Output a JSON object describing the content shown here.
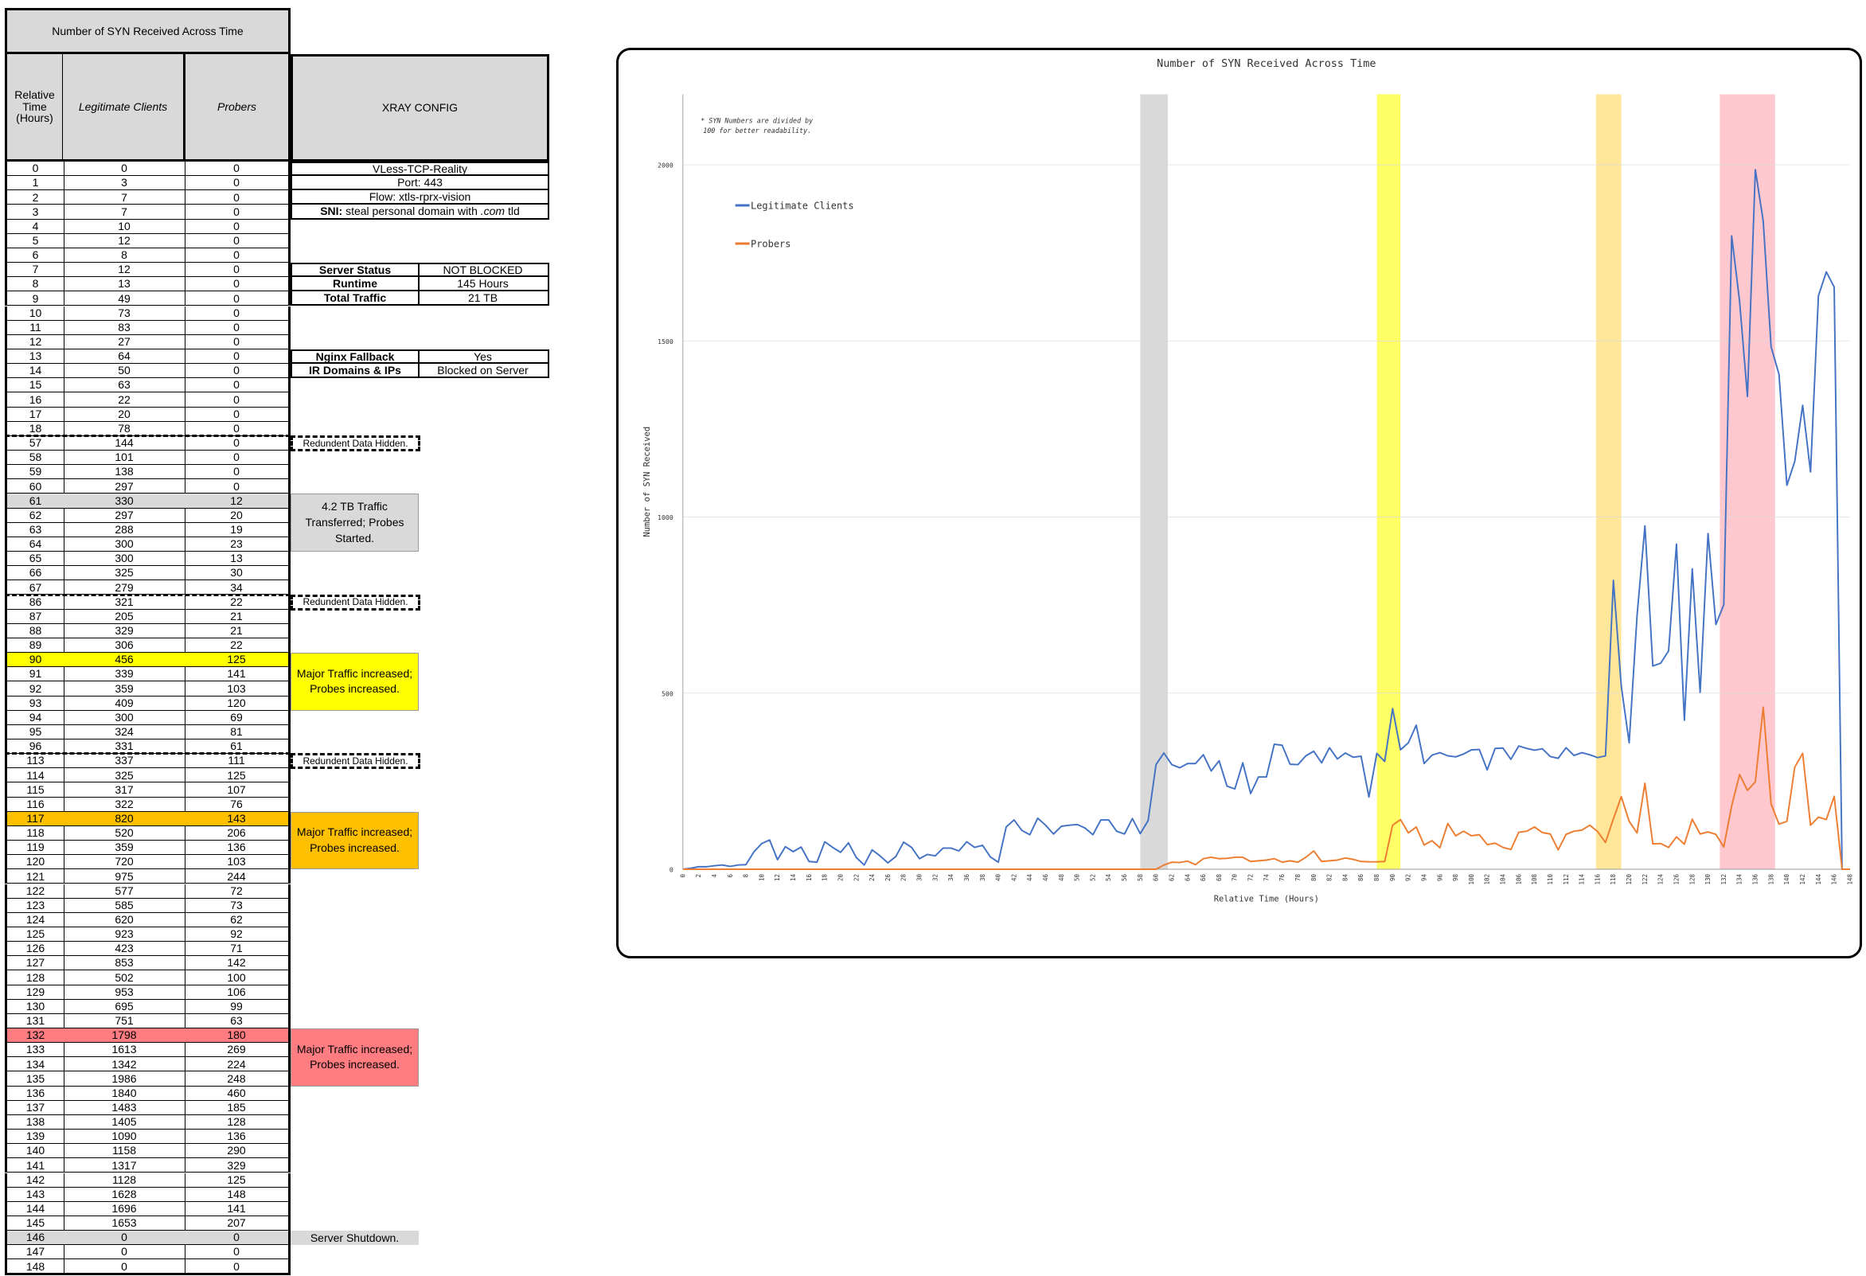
{
  "table": {
    "title": "Number of SYN Received Across Time",
    "col_time": "Relative Time (Hours)",
    "col_legit": "Legitimate Clients",
    "col_probers": "Probers",
    "rows": [
      {
        "t": "0",
        "l": "0",
        "p": "0"
      },
      {
        "t": "1",
        "l": "3",
        "p": "0"
      },
      {
        "t": "2",
        "l": "7",
        "p": "0"
      },
      {
        "t": "3",
        "l": "7",
        "p": "0"
      },
      {
        "t": "4",
        "l": "10",
        "p": "0"
      },
      {
        "t": "5",
        "l": "12",
        "p": "0"
      },
      {
        "t": "6",
        "l": "8",
        "p": "0"
      },
      {
        "t": "7",
        "l": "12",
        "p": "0"
      },
      {
        "t": "8",
        "l": "13",
        "p": "0"
      },
      {
        "t": "9",
        "l": "49",
        "p": "0"
      },
      {
        "t": "10",
        "l": "73",
        "p": "0"
      },
      {
        "t": "11",
        "l": "83",
        "p": "0"
      },
      {
        "t": "12",
        "l": "27",
        "p": "0"
      },
      {
        "t": "13",
        "l": "64",
        "p": "0"
      },
      {
        "t": "14",
        "l": "50",
        "p": "0"
      },
      {
        "t": "15",
        "l": "63",
        "p": "0"
      },
      {
        "t": "16",
        "l": "22",
        "p": "0"
      },
      {
        "t": "17",
        "l": "20",
        "p": "0"
      },
      {
        "t": "18",
        "l": "78",
        "p": "0"
      },
      {
        "t": "57",
        "l": "144",
        "p": "0"
      },
      {
        "t": "58",
        "l": "101",
        "p": "0"
      },
      {
        "t": "59",
        "l": "138",
        "p": "0"
      },
      {
        "t": "60",
        "l": "297",
        "p": "0"
      },
      {
        "t": "61",
        "l": "330",
        "p": "12"
      },
      {
        "t": "62",
        "l": "297",
        "p": "20"
      },
      {
        "t": "63",
        "l": "288",
        "p": "19"
      },
      {
        "t": "64",
        "l": "300",
        "p": "23"
      },
      {
        "t": "65",
        "l": "300",
        "p": "13"
      },
      {
        "t": "66",
        "l": "325",
        "p": "30"
      },
      {
        "t": "67",
        "l": "279",
        "p": "34"
      },
      {
        "t": "86",
        "l": "321",
        "p": "22"
      },
      {
        "t": "87",
        "l": "205",
        "p": "21"
      },
      {
        "t": "88",
        "l": "329",
        "p": "21"
      },
      {
        "t": "89",
        "l": "306",
        "p": "22"
      },
      {
        "t": "90",
        "l": "456",
        "p": "125"
      },
      {
        "t": "91",
        "l": "339",
        "p": "141"
      },
      {
        "t": "92",
        "l": "359",
        "p": "103"
      },
      {
        "t": "93",
        "l": "409",
        "p": "120"
      },
      {
        "t": "94",
        "l": "300",
        "p": "69"
      },
      {
        "t": "95",
        "l": "324",
        "p": "81"
      },
      {
        "t": "96",
        "l": "331",
        "p": "61"
      },
      {
        "t": "113",
        "l": "337",
        "p": "111"
      },
      {
        "t": "114",
        "l": "325",
        "p": "125"
      },
      {
        "t": "115",
        "l": "317",
        "p": "107"
      },
      {
        "t": "116",
        "l": "322",
        "p": "76"
      },
      {
        "t": "117",
        "l": "820",
        "p": "143"
      },
      {
        "t": "118",
        "l": "520",
        "p": "206"
      },
      {
        "t": "119",
        "l": "359",
        "p": "136"
      },
      {
        "t": "120",
        "l": "720",
        "p": "103"
      },
      {
        "t": "121",
        "l": "975",
        "p": "244"
      },
      {
        "t": "122",
        "l": "577",
        "p": "72"
      },
      {
        "t": "123",
        "l": "585",
        "p": "73"
      },
      {
        "t": "124",
        "l": "620",
        "p": "62"
      },
      {
        "t": "125",
        "l": "923",
        "p": "92"
      },
      {
        "t": "126",
        "l": "423",
        "p": "71"
      },
      {
        "t": "127",
        "l": "853",
        "p": "142"
      },
      {
        "t": "128",
        "l": "502",
        "p": "100"
      },
      {
        "t": "129",
        "l": "953",
        "p": "106"
      },
      {
        "t": "130",
        "l": "695",
        "p": "99"
      },
      {
        "t": "131",
        "l": "751",
        "p": "63"
      },
      {
        "t": "132",
        "l": "1798",
        "p": "180"
      },
      {
        "t": "133",
        "l": "1613",
        "p": "269"
      },
      {
        "t": "134",
        "l": "1342",
        "p": "224"
      },
      {
        "t": "135",
        "l": "1986",
        "p": "248"
      },
      {
        "t": "136",
        "l": "1840",
        "p": "460"
      },
      {
        "t": "137",
        "l": "1483",
        "p": "185"
      },
      {
        "t": "138",
        "l": "1405",
        "p": "128"
      },
      {
        "t": "139",
        "l": "1090",
        "p": "136"
      },
      {
        "t": "140",
        "l": "1158",
        "p": "290"
      },
      {
        "t": "141",
        "l": "1317",
        "p": "329"
      },
      {
        "t": "142",
        "l": "1128",
        "p": "125"
      },
      {
        "t": "143",
        "l": "1628",
        "p": "148"
      },
      {
        "t": "144",
        "l": "1696",
        "p": "141"
      },
      {
        "t": "145",
        "l": "1653",
        "p": "207"
      },
      {
        "t": "146",
        "l": "0",
        "p": "0"
      },
      {
        "t": "147",
        "l": "0",
        "p": "0"
      },
      {
        "t": "148",
        "l": "0",
        "p": "0"
      }
    ],
    "highlighted_rows": {
      "61": "#d9d9d9",
      "90": "#ffff00",
      "117": "#ffc000",
      "132": "#ff7c80",
      "146": "#d9d9d9"
    },
    "dashed_after_times": [
      "18",
      "67",
      "96"
    ]
  },
  "xray": {
    "header": "XRAY CONFIG",
    "protocol": "VLess-TCP-Reality",
    "port": "Port: 443",
    "flow": "Flow: xtls-rprx-vision",
    "sni_label": "SNI:",
    "sni_text": "steal personal domain with",
    "sni_em": ".com",
    "sni_tail": "tld",
    "status": [
      {
        "k": "Server Status",
        "v": "NOT BLOCKED"
      },
      {
        "k": "Runtime",
        "v": "145 Hours"
      },
      {
        "k": "Total Traffic",
        "v": "21 TB"
      }
    ],
    "extra": [
      {
        "k": "Nginx Fallback",
        "v": "Yes"
      },
      {
        "k": "IR Domains & IPs",
        "v": "Blocked on Server"
      }
    ]
  },
  "notes": {
    "hidden1": "Redundent Data Hidden.",
    "hidden2": "Redundent Data Hidden.",
    "hidden3": "Redundent Data Hidden.",
    "n61": "4.2 TB Traffic Transferred; Probes Started.",
    "n90": "Major Traffic increased; Probes increased.",
    "n117": "Major Traffic increased; Probes increased.",
    "n132": "Major Traffic increased; Probes increased.",
    "n146": "Server Shutdown."
  },
  "chart_data": {
    "type": "line",
    "title": "Number of SYN Received Across Time",
    "xlabel": "Relative Time (Hours)",
    "ylabel": "Number of SYN Received",
    "annotation": "* SYN Numbers are divided by 100 for better readability.",
    "xlim": [
      0,
      148
    ],
    "ylim": [
      0,
      2000
    ],
    "yticks": [
      0,
      500,
      1000,
      1500,
      2000
    ],
    "xtick_step": 2,
    "grid": true,
    "legend_position": "upper-left",
    "x": [
      0,
      1,
      2,
      3,
      4,
      5,
      6,
      7,
      8,
      9,
      10,
      11,
      12,
      13,
      14,
      15,
      16,
      17,
      18,
      19,
      20,
      21,
      22,
      23,
      24,
      25,
      26,
      27,
      28,
      29,
      30,
      31,
      32,
      33,
      34,
      35,
      36,
      37,
      38,
      39,
      40,
      41,
      42,
      43,
      44,
      45,
      46,
      47,
      48,
      49,
      50,
      51,
      52,
      53,
      54,
      55,
      56,
      57,
      58,
      59,
      60,
      61,
      62,
      63,
      64,
      65,
      66,
      67,
      68,
      69,
      70,
      71,
      72,
      73,
      74,
      75,
      76,
      77,
      78,
      79,
      80,
      81,
      82,
      83,
      84,
      85,
      86,
      87,
      88,
      89,
      90,
      91,
      92,
      93,
      94,
      95,
      96,
      97,
      98,
      99,
      100,
      101,
      102,
      103,
      104,
      105,
      106,
      107,
      108,
      109,
      110,
      111,
      112,
      113,
      114,
      115,
      116,
      117,
      118,
      119,
      120,
      121,
      122,
      123,
      124,
      125,
      126,
      127,
      128,
      129,
      130,
      131,
      132,
      133,
      134,
      135,
      136,
      137,
      138,
      139,
      140,
      141,
      142,
      143,
      144,
      145,
      146,
      147,
      148
    ],
    "series": [
      {
        "name": "Legitimate Clients",
        "color": "#4472c4",
        "values": [
          0,
          3,
          7,
          7,
          10,
          12,
          8,
          12,
          13,
          49,
          73,
          83,
          27,
          64,
          50,
          63,
          22,
          20,
          78,
          62,
          48,
          75,
          33,
          12,
          55,
          38,
          18,
          36,
          77,
          62,
          30,
          42,
          38,
          60,
          60,
          52,
          78,
          62,
          68,
          35,
          20,
          120,
          140,
          110,
          98,
          145,
          125,
          100,
          122,
          125,
          127,
          117,
          98,
          140,
          140,
          108,
          100,
          144,
          101,
          138,
          297,
          330,
          297,
          288,
          300,
          300,
          325,
          279,
          308,
          236,
          228,
          302,
          215,
          262,
          262,
          355,
          352,
          298,
          297,
          322,
          335,
          302,
          345,
          313,
          330,
          318,
          321,
          205,
          329,
          306,
          456,
          339,
          359,
          409,
          300,
          324,
          331,
          322,
          319,
          327,
          339,
          340,
          282,
          343,
          344,
          312,
          350,
          343,
          338,
          342,
          320,
          315,
          345,
          323,
          331,
          325,
          317,
          322,
          820,
          520,
          359,
          720,
          975,
          577,
          585,
          620,
          923,
          423,
          853,
          502,
          953,
          695,
          751,
          1798,
          1613,
          1342,
          1986,
          1840,
          1483,
          1405,
          1090,
          1158,
          1317,
          1128,
          1628,
          1696,
          1653,
          0,
          0,
          0
        ]
      },
      {
        "name": "Probers",
        "color": "#ed7d31",
        "values": [
          0,
          0,
          0,
          0,
          0,
          0,
          0,
          0,
          0,
          0,
          0,
          0,
          0,
          0,
          0,
          0,
          0,
          0,
          0,
          0,
          0,
          0,
          0,
          0,
          0,
          0,
          0,
          0,
          0,
          0,
          0,
          0,
          0,
          0,
          0,
          0,
          0,
          0,
          0,
          0,
          0,
          0,
          0,
          0,
          0,
          0,
          0,
          0,
          0,
          0,
          0,
          0,
          0,
          0,
          0,
          0,
          0,
          0,
          0,
          0,
          0,
          12,
          20,
          19,
          23,
          13,
          30,
          34,
          30,
          31,
          34,
          34,
          22,
          24,
          26,
          30,
          20,
          24,
          20,
          34,
          52,
          22,
          24,
          26,
          32,
          28,
          22,
          21,
          21,
          22,
          125,
          141,
          103,
          120,
          69,
          81,
          61,
          130,
          95,
          108,
          95,
          98,
          70,
          74,
          62,
          56,
          105,
          108,
          120,
          104,
          100,
          55,
          99,
          108,
          111,
          125,
          107,
          76,
          143,
          206,
          136,
          103,
          244,
          72,
          73,
          62,
          92,
          71,
          142,
          100,
          106,
          99,
          63,
          180,
          269,
          224,
          248,
          460,
          185,
          128,
          136,
          290,
          329,
          125,
          148,
          141,
          207,
          0,
          0,
          0
        ]
      }
    ],
    "bands": [
      {
        "from": 58,
        "to": 61.5,
        "color": "#d9d9d9"
      },
      {
        "from": 88,
        "to": 91,
        "color": "#ffff66"
      },
      {
        "from": 115.8,
        "to": 119,
        "color": "#ffe699"
      },
      {
        "from": 131.5,
        "to": 138.5,
        "color": "#ffc7ce"
      }
    ]
  }
}
